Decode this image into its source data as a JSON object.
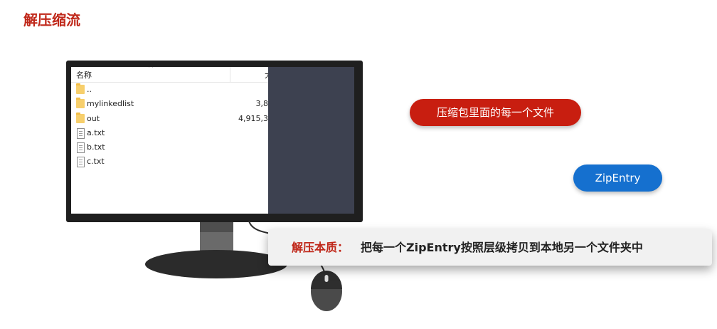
{
  "slide": {
    "title": "解压缩流"
  },
  "explorer": {
    "header": {
      "name_col": "名称",
      "size_col": "大"
    },
    "files": [
      {
        "name": "..",
        "type": "folder",
        "size": ""
      },
      {
        "name": "mylinkedlist",
        "type": "folder",
        "size": "3,8"
      },
      {
        "name": "out",
        "type": "folder",
        "size": "4,915,3"
      },
      {
        "name": "a.txt",
        "type": "file",
        "size": ""
      },
      {
        "name": "b.txt",
        "type": "file",
        "size": ""
      },
      {
        "name": "c.txt",
        "type": "file",
        "size": ""
      }
    ]
  },
  "labels": {
    "red_pill": "压缩包里面的每一个文件",
    "blue_pill": "ZipEntry"
  },
  "banner": {
    "label": "解压本质：",
    "text": "把每一个ZipEntry按照层级拷贝到本地另一个文件夹中"
  },
  "colors": {
    "accent_red": "#c0281a",
    "pill_red": "#c81e10",
    "pill_blue": "#1570cf",
    "screen_dark": "#3d4150"
  },
  "icons": [
    "folder-icon",
    "text-file-icon",
    "sort-up-icon",
    "mouse-icon"
  ]
}
